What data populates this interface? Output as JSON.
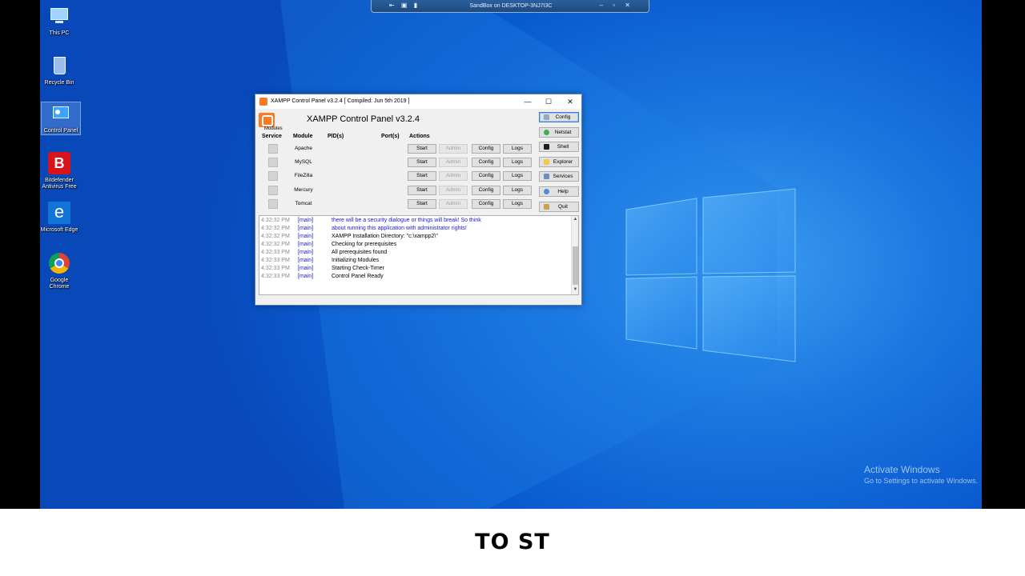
{
  "desktop_icons": [
    {
      "label": "This PC",
      "icon": "this-pc-icon"
    },
    {
      "label": "Recycle Bin",
      "icon": "recycle-bin-icon"
    },
    {
      "label": "Control Panel",
      "icon": "control-panel-icon"
    },
    {
      "label": "Bitdefender Antivirus Free",
      "icon": "bitdefender-icon"
    },
    {
      "label": "Microsoft Edge",
      "icon": "edge-icon"
    },
    {
      "label": "Google Chrome",
      "icon": "chrome-icon"
    }
  ],
  "sandbox_bar": {
    "title": "SandBox on DESKTOP-3NJ7I3C",
    "left_glyphs": "⇤ ▣ ▮",
    "right_glyphs": "– ▫ ✕"
  },
  "window": {
    "title": "XAMPP Control Panel v3.2.4   [ Compiled: Jun 5th 2019 ]",
    "heading": "XAMPP Control Panel v3.2.4",
    "controls": {
      "minimize": "—",
      "maximize": "☐",
      "close": "✕"
    },
    "headers": {
      "modules": "Modules",
      "service": "Service",
      "module": "Module",
      "pids": "PID(s)",
      "ports": "Port(s)",
      "actions": "Actions"
    },
    "modules": [
      {
        "name": "Apache",
        "start": "Start",
        "admin": "Admin",
        "config": "Config",
        "logs": "Logs"
      },
      {
        "name": "MySQL",
        "start": "Start",
        "admin": "Admin",
        "config": "Config",
        "logs": "Logs"
      },
      {
        "name": "FileZilla",
        "start": "Start",
        "admin": "Admin",
        "config": "Config",
        "logs": "Logs"
      },
      {
        "name": "Mercury",
        "start": "Start",
        "admin": "Admin",
        "config": "Config",
        "logs": "Logs"
      },
      {
        "name": "Tomcat",
        "start": "Start",
        "admin": "Admin",
        "config": "Config",
        "logs": "Logs"
      }
    ],
    "side_buttons": [
      {
        "label": "Config",
        "icon": "wrench-icon"
      },
      {
        "label": "Netstat",
        "icon": "globe-icon"
      },
      {
        "label": "Shell",
        "icon": "terminal-icon"
      },
      {
        "label": "Explorer",
        "icon": "folder-icon"
      },
      {
        "label": "Services",
        "icon": "services-icon"
      },
      {
        "label": "Help",
        "icon": "help-icon"
      },
      {
        "label": "Quit",
        "icon": "quit-icon"
      }
    ],
    "log": [
      {
        "time": "4:32:32 PM",
        "module": "[main]",
        "message": "there will be a security dialogue or things will break! So think",
        "color": "#1a1ad0"
      },
      {
        "time": "4:32:32 PM",
        "module": "[main]",
        "message": "about running this application with administrator rights!",
        "color": "#1a1ad0"
      },
      {
        "time": "4:32:32 PM",
        "module": "[main]",
        "message": "XAMPP Installation Directory: \"c:\\xampp2\\\"",
        "color": "#000000"
      },
      {
        "time": "4:32:32 PM",
        "module": "[main]",
        "message": "Checking for prerequisites",
        "color": "#000000"
      },
      {
        "time": "4:32:33 PM",
        "module": "[main]",
        "message": "All prerequisites found",
        "color": "#000000"
      },
      {
        "time": "4:32:33 PM",
        "module": "[main]",
        "message": "Initializing Modules",
        "color": "#000000"
      },
      {
        "time": "4:32:33 PM",
        "module": "[main]",
        "message": "Starting Check-Timer",
        "color": "#000000"
      },
      {
        "time": "4:32:33 PM",
        "module": "[main]",
        "message": "Control Panel Ready",
        "color": "#000000"
      }
    ]
  },
  "activate_windows": {
    "title": "Activate Windows",
    "subtitle": "Go to Settings to activate Windows."
  },
  "caption": "TO ST"
}
